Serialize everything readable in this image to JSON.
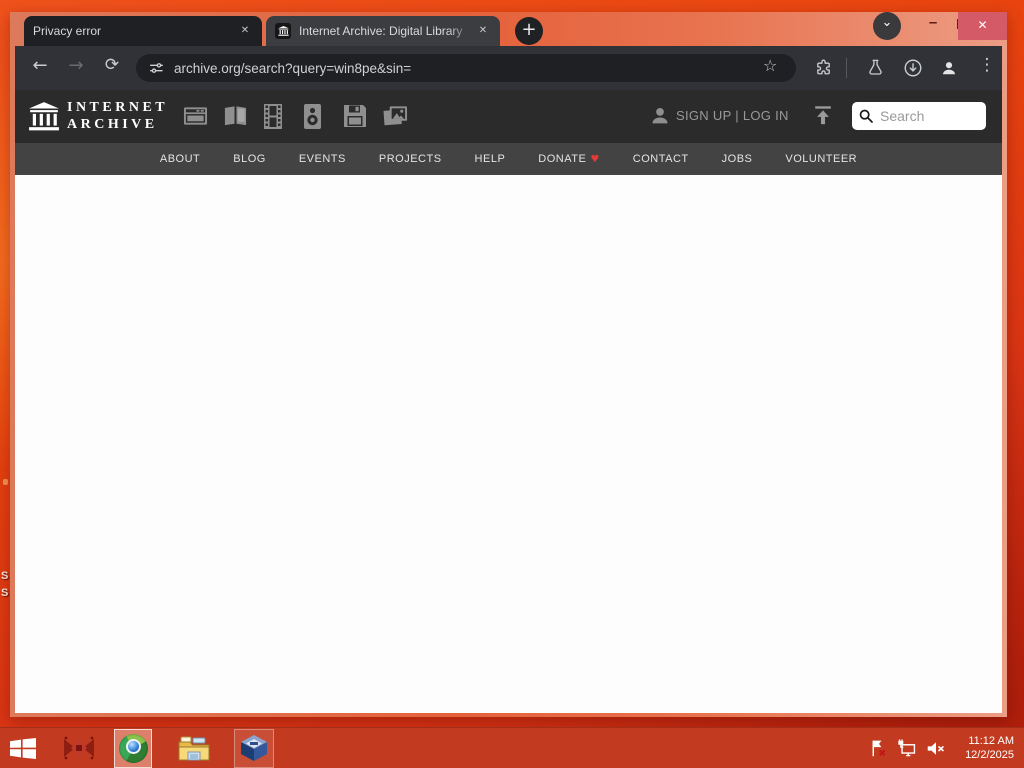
{
  "browser": {
    "tabs": [
      {
        "title": "Privacy error"
      },
      {
        "title": "Internet Archive: Digital Library"
      }
    ],
    "url": "archive.org/search?query=win8pe&sin=",
    "toolbar_icons": [
      "back",
      "forward",
      "reload",
      "tune",
      "bookmark-star",
      "extensions",
      "labs-flask",
      "downloads",
      "profile",
      "menu"
    ],
    "window_controls": [
      "tab-search",
      "minimize",
      "maximize",
      "close"
    ]
  },
  "glyphs": {
    "back": "←",
    "forward": "→",
    "reload": "⟳",
    "star": "☆",
    "kebab": "⋮",
    "new_tab": "+",
    "close_tab": "✕",
    "window_close": "✕",
    "chevron_down": "⌄",
    "minimize": "–",
    "heart": "♥"
  },
  "archive_header": {
    "logo_line1": "INTERNET",
    "logo_line2": "ARCHIVE",
    "media_type_icons": [
      "web",
      "texts",
      "video",
      "audio",
      "software",
      "images"
    ],
    "signup_login": "SIGN UP | LOG IN",
    "upload_icon": "upload",
    "search_placeholder": "Search",
    "nav_items": [
      "ABOUT",
      "BLOG",
      "EVENTS",
      "PROJECTS",
      "HELP",
      "DONATE",
      "CONTACT",
      "JOBS",
      "VOLUNTEER"
    ],
    "donate_heart_icon": "heart"
  },
  "taskbar": {
    "app_icons": [
      "start",
      "red-app",
      "chrome",
      "file-explorer",
      "virtualbox"
    ],
    "tray_icons": [
      "action-center-flag",
      "network",
      "volume-muted"
    ],
    "time": "11:12 AM",
    "date": "12/2/2025"
  },
  "desktop": {
    "label_fragments": [
      "S",
      "S"
    ]
  },
  "colors": {
    "desktop_top": "#f0521c",
    "desktop_bottom": "#c52b10",
    "frame_salmon": "#ec9d85",
    "toolbar": "#303237",
    "omnibox": "#1e2023",
    "ia_header": "#2b2b2b",
    "ia_nav": "#434343",
    "taskbar": "#c23a1f",
    "close_button": "#d45a68",
    "heart_red": "#e53935"
  }
}
